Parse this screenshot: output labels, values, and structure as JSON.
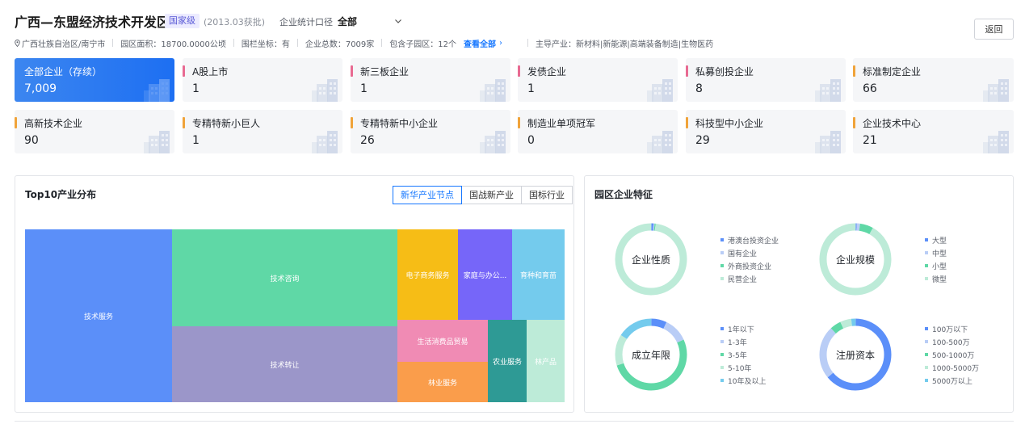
{
  "header": {
    "title": "广西—东盟经济技术开发区",
    "level_badge": "国家级",
    "approved": "(2013.03获批)",
    "stat_label": "企业统计口径",
    "stat_value": "全部",
    "back_label": "返回"
  },
  "meta": {
    "location": "广西壮族自治区/南宁市",
    "area": "园区面积：18700.0000公顷",
    "fence": "围栏坐标：有",
    "total": "企业总数：7009家",
    "sub_parks": "包含子园区：12个",
    "view_all": "查看全部",
    "chevron": "›",
    "industries": "主导产业：新材料|新能源|高端装备制造|生物医药"
  },
  "cards": [
    {
      "label": "全部企业（存续）",
      "value": "7,009",
      "color": "#1d6ff2",
      "active": true
    },
    {
      "label": "A股上市",
      "value": "1",
      "color": "#e86a92"
    },
    {
      "label": "新三板企业",
      "value": "1",
      "color": "#e86a92"
    },
    {
      "label": "发债企业",
      "value": "1",
      "color": "#e86a92"
    },
    {
      "label": "私募创投企业",
      "value": "8",
      "color": "#e86a92"
    },
    {
      "label": "标准制定企业",
      "value": "66",
      "color": "#f0a33a"
    },
    {
      "label": "高新技术企业",
      "value": "90",
      "color": "#f0a33a"
    },
    {
      "label": "专精特新小巨人",
      "value": "1",
      "color": "#f0a33a"
    },
    {
      "label": "专精特新中小企业",
      "value": "26",
      "color": "#f0a33a"
    },
    {
      "label": "制造业单项冠军",
      "value": "0",
      "color": "#f0a33a"
    },
    {
      "label": "科技型中小企业",
      "value": "29",
      "color": "#f0a33a"
    },
    {
      "label": "企业技术中心",
      "value": "21",
      "color": "#f0a33a"
    }
  ],
  "top10": {
    "title": "Top10产业分布",
    "tabs": [
      "新华产业节点",
      "国战新产业",
      "国标行业"
    ],
    "active_tab": 0,
    "items": [
      {
        "name": "技术服务",
        "color": "#5b8ff9"
      },
      {
        "name": "技术咨询",
        "color": "#5fd8a6"
      },
      {
        "name": "技术转让",
        "color": "#9b96c9"
      },
      {
        "name": "电子商务服务",
        "color": "#f6bd16"
      },
      {
        "name": "家庭与办公...",
        "color": "#7666f9"
      },
      {
        "name": "育种和育苗",
        "color": "#74cbed"
      },
      {
        "name": "生活消费品贸易",
        "color": "#f08bb4"
      },
      {
        "name": "林业服务",
        "color": "#fa9d4b"
      },
      {
        "name": "农业服务",
        "color": "#2e9a95"
      },
      {
        "name": "林产品",
        "color": "#bdebd8"
      }
    ]
  },
  "features": {
    "title": "园区企业特征",
    "charts": [
      {
        "name": "企业性质",
        "legend": [
          "港澳台投资企业",
          "国有企业",
          "外商投资企业",
          "民营企业"
        ],
        "colors": [
          "#5b8ff9",
          "#b9cdf6",
          "#5fd8a6",
          "#bdebd8"
        ],
        "values": [
          1,
          0.5,
          0.5,
          98
        ]
      },
      {
        "name": "企业规模",
        "legend": [
          "大型",
          "中型",
          "小型",
          "微型"
        ],
        "colors": [
          "#5b8ff9",
          "#b9cdf6",
          "#5fd8a6",
          "#bdebd8"
        ],
        "values": [
          0.5,
          1.5,
          6,
          92
        ]
      },
      {
        "name": "成立年限",
        "legend": [
          "1年以下",
          "1-3年",
          "3-5年",
          "5-10年",
          "10年及以上"
        ],
        "colors": [
          "#5b8ff9",
          "#b9cdf6",
          "#5fd8a6",
          "#bdebd8",
          "#74cbed"
        ],
        "values": [
          7,
          11,
          52,
          14,
          16
        ]
      },
      {
        "name": "注册资本",
        "legend": [
          "100万以下",
          "100-500万",
          "500-1000万",
          "1000-5000万",
          "5000万以上"
        ],
        "colors": [
          "#5b8ff9",
          "#b9cdf6",
          "#5fd8a6",
          "#bdebd8",
          "#74cbed"
        ],
        "values": [
          64,
          24,
          5,
          5,
          2
        ]
      }
    ]
  }
}
